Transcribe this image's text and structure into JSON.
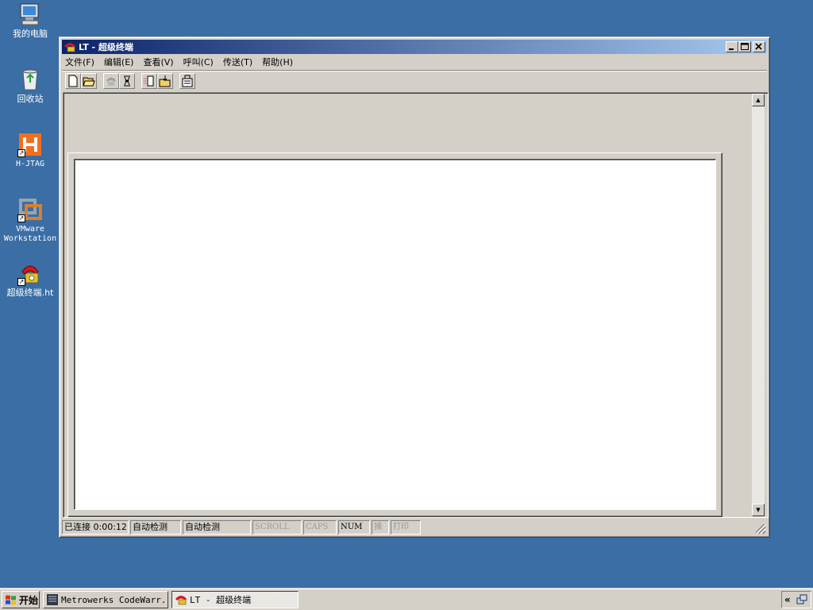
{
  "desktop": {
    "icons": [
      {
        "label": "我的电脑",
        "icon": "my-computer-icon"
      },
      {
        "label": "回收站",
        "icon": "recycle-bin-icon"
      },
      {
        "label": "H-JTAG",
        "icon": "hjtag-icon"
      },
      {
        "label": "VMware\nWorkstation",
        "icon": "vmware-icon"
      },
      {
        "label": "超级终端.ht",
        "icon": "hyperterminal-icon"
      }
    ]
  },
  "window": {
    "title": "LT - 超级终端",
    "menu": [
      "文件(F)",
      "编辑(E)",
      "查看(V)",
      "呼叫(C)",
      "传送(T)",
      "帮助(H)"
    ],
    "toolbar": [
      "new-icon",
      "open-icon",
      "call-icon",
      "disconnect-icon",
      "send-icon",
      "receive-icon",
      "properties-icon"
    ],
    "status": {
      "connection": "已连接 0:00:12",
      "detect1": "自动检测",
      "detect2": "自动检测",
      "scroll": "SCROLL",
      "caps": "CAPS",
      "num": "NUM",
      "capture": "捕",
      "print": "打印"
    }
  },
  "taskbar": {
    "start": "开始",
    "tasks": [
      {
        "label": "Metrowerks CodeWarr...",
        "active": false
      },
      {
        "label": "LT - 超级终端",
        "active": true
      }
    ],
    "tray_arrow": "«"
  },
  "colors": {
    "desktop": "#3a6ea5",
    "title_start": "#0a246a",
    "title_end": "#a6caf0",
    "face": "#d4d0c8"
  }
}
